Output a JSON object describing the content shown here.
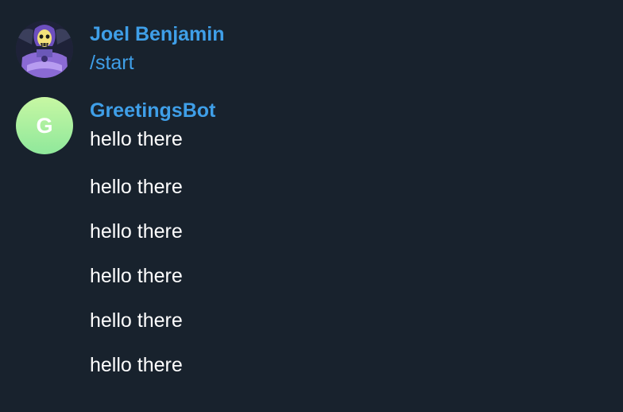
{
  "conversation": {
    "groups": [
      {
        "sender": "Joel Benjamin",
        "avatar_icon": "skeletor-avatar-icon",
        "messages": [
          {
            "text": "/start",
            "kind": "command"
          }
        ]
      },
      {
        "sender": "GreetingsBot",
        "avatar_initial": "G",
        "avatar_gradient": [
          "#c7f7a3",
          "#8fe89b"
        ],
        "messages": [
          {
            "text": "hello there"
          },
          {
            "text": "hello there"
          },
          {
            "text": "hello there"
          },
          {
            "text": "hello there"
          },
          {
            "text": "hello there"
          },
          {
            "text": "hello there"
          }
        ]
      }
    ]
  },
  "colors": {
    "background": "#18222d",
    "accent": "#3f9fe8",
    "text": "#ffffff"
  }
}
